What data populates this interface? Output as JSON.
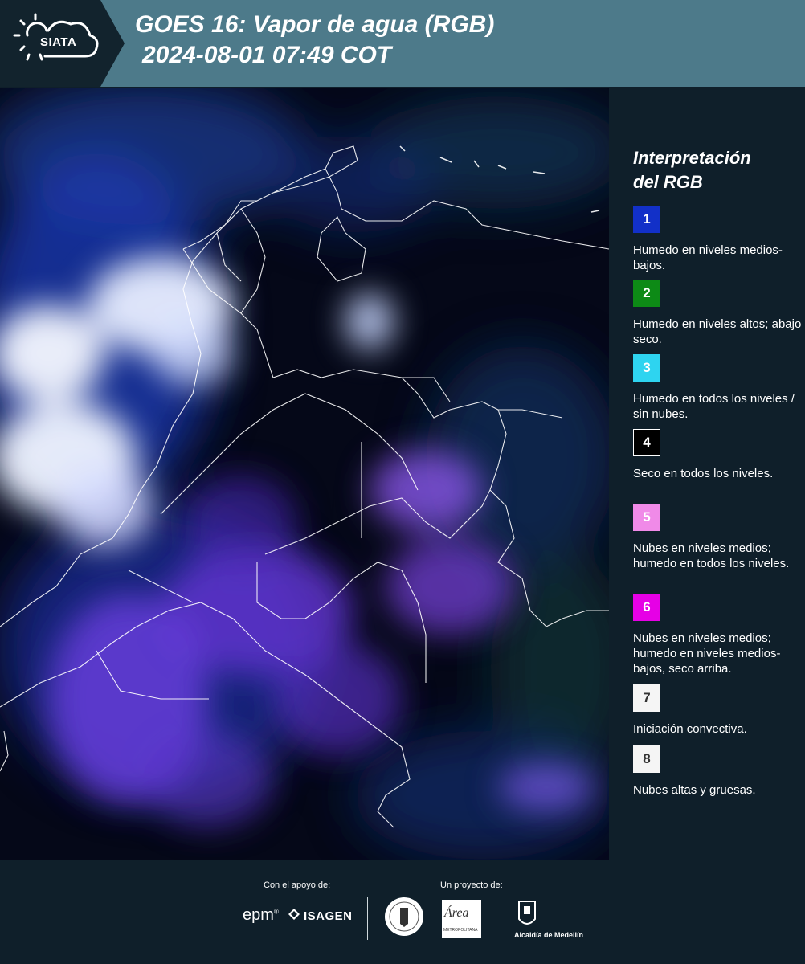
{
  "header": {
    "logo_text": "SIATA",
    "title_line1": "GOES 16: Vapor de agua (RGB)",
    "title_line2": "2024-08-01 07:49 COT",
    "background": "#4d7a8a"
  },
  "map": {
    "description_colors": {
      "background": "#050818",
      "moist_mid_low": "#1a2fa0",
      "clouds_mid": "#7a40e0",
      "high_thick_clouds": "#f4f8ff"
    },
    "coastline_color": "#ffffff"
  },
  "legend": {
    "title_line1": "Interpretación",
    "title_line2": "del RGB",
    "items": [
      {
        "number": "1",
        "color": "#1230c8",
        "text_color": "#ffffff",
        "label": "Humedo en niveles medios-bajos."
      },
      {
        "number": "2",
        "color": "#0d8a16",
        "text_color": "#ffffff",
        "label": "Humedo en niveles altos; abajo seco."
      },
      {
        "number": "3",
        "color": "#2ed4f0",
        "text_color": "#ffffff",
        "label": "Humedo en todos los niveles / sin nubes."
      },
      {
        "number": "4",
        "color": "#000000",
        "text_color": "#ffffff",
        "label": "Seco en todos los niveles."
      },
      {
        "number": "5",
        "color": "#f08ae8",
        "text_color": "#ffffff",
        "label": "Nubes en niveles medios; humedo en todos los niveles."
      },
      {
        "number": "6",
        "color": "#e600e6",
        "text_color": "#ffffff",
        "label": "Nubes en niveles medios; humedo en niveles medios-bajos, seco arriba."
      },
      {
        "number": "7",
        "color": "#f5f5f5",
        "text_color": "#333333",
        "label": "Iniciación convectiva."
      },
      {
        "number": "8",
        "color": "#f5f5f5",
        "text_color": "#333333",
        "label": "Nubes altas y gruesas."
      }
    ]
  },
  "footer": {
    "support_label": "Con el apoyo de:",
    "project_label": "Un proyecto de:",
    "epm_text": "epm",
    "epm_mark": "®",
    "isagen_text": "ISAGEN",
    "area_text": "Área",
    "area_subtext": "METROPOLITANA",
    "alcaldia_text": "Alcaldía de Medellín"
  }
}
